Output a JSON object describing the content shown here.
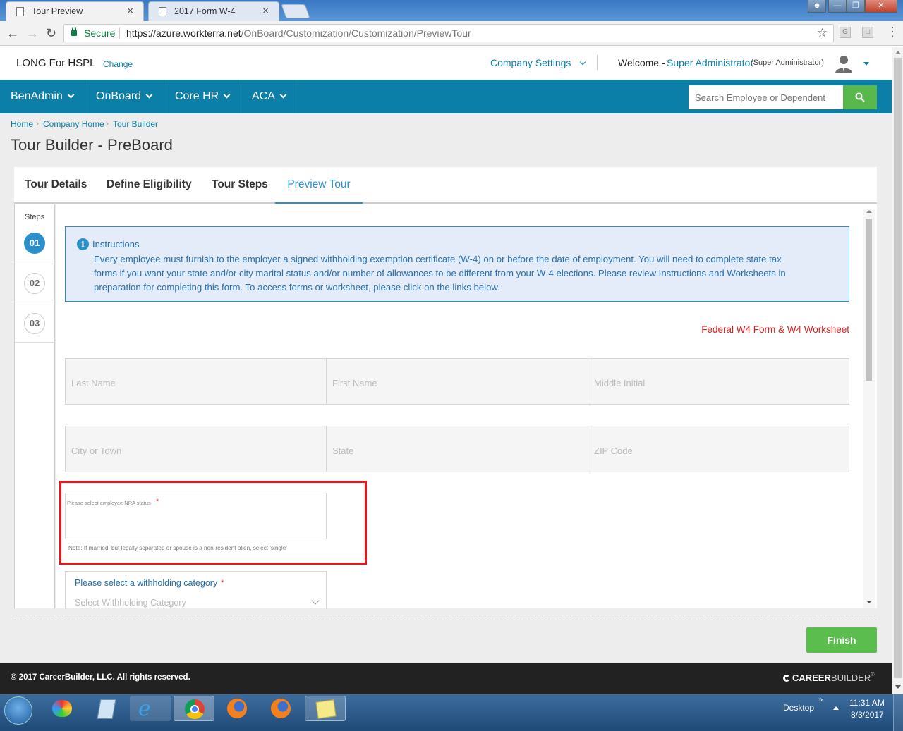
{
  "browser": {
    "tabs": [
      {
        "label": "Tour Preview",
        "active": true
      },
      {
        "label": "2017 Form W-4",
        "active": false
      }
    ],
    "secure_label": "Secure",
    "url_base": "https://azure.workterra.net",
    "url_path": "/OnBoard/Customization/Customization/PreviewTour"
  },
  "header": {
    "company": "LONG For HSPL",
    "change_link": "Change",
    "company_settings": "Company Settings",
    "welcome": "Welcome -",
    "user": "Super Administrator",
    "role": "(Super Administrator)"
  },
  "nav": {
    "items": [
      "BenAdmin",
      "OnBoard",
      "Core HR",
      "ACA"
    ],
    "search_placeholder": "Search Employee or Dependent"
  },
  "breadcrumb": [
    "Home",
    "Company Home",
    "Tour Builder"
  ],
  "page_title": "Tour Builder - PreBoard",
  "tabs": [
    "Tour Details",
    "Define Eligibility",
    "Tour Steps",
    "Preview Tour"
  ],
  "active_tab": "Preview Tour",
  "steps": {
    "label": "Steps",
    "items": [
      "01",
      "02",
      "03"
    ],
    "active": "01"
  },
  "instructions": {
    "title": "Instructions",
    "line1": "Every employee must furnish to the employer a signed withholding exemption certificate (W-4) on or before the date of employment. You will need to complete state tax",
    "line2": "forms if you want your state and/or city marital status and/or number of allowances to be different from your W-4 elections. Please review Instructions and Worksheets in",
    "line3": "preparation for completing this form. To access forms or worksheet, please click on the links below."
  },
  "w4_link": "Federal W4 Form & W4 Worksheet",
  "fields": {
    "last_name": "Last Name",
    "first_name": "First Name",
    "middle_initial": "Middle Initial",
    "city": "City or Town",
    "state": "State",
    "zip": "ZIP Code"
  },
  "nra": {
    "label": "Please select employee NRA status",
    "required": "*",
    "note": "Note: If married, but legally separated or spouse is a non-resident alien, select 'single'"
  },
  "withholding": {
    "label": "Please select a withholding category",
    "required": "*",
    "placeholder": "Select Withholding Category"
  },
  "finish_label": "Finish",
  "footer": {
    "copyright": "© 2017 CareerBuilder, LLC. All rights reserved.",
    "brand_bold": "CAREER",
    "brand_light": "BUILDER",
    "brand_mark": "®"
  },
  "taskbar": {
    "desktop_label": "Desktop",
    "time": "11:31 AM",
    "date": "8/3/2017"
  },
  "colors": {
    "nav_bg": "#0b7fa8",
    "accent_blue": "#2a8fcb",
    "green": "#5cbd4f",
    "link_red": "#e02020",
    "highlight_red": "#e8141e"
  }
}
